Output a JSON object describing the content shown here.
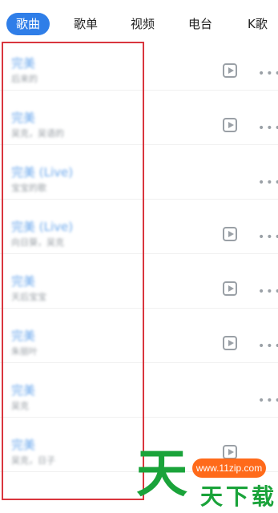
{
  "tabs": [
    {
      "label": "歌曲"
    },
    {
      "label": "歌单"
    },
    {
      "label": "视频"
    },
    {
      "label": "电台"
    },
    {
      "label": "K歌"
    }
  ],
  "songs": [
    {
      "title": "完美",
      "subtitle": "后来的"
    },
    {
      "title": "完美",
      "subtitle": "吴克，吴语的"
    },
    {
      "title": "完美 (Live)",
      "subtitle": "宝宝的歌"
    },
    {
      "title": "完美 (Live)",
      "subtitle": "向日葵，吴克"
    },
    {
      "title": "完美",
      "subtitle": "天后宝宝"
    },
    {
      "title": "完美",
      "subtitle": "朱丽叶"
    },
    {
      "title": "完美",
      "subtitle": "吴克"
    },
    {
      "title": "完美",
      "subtitle": "吴克，日子"
    }
  ],
  "watermark": {
    "url": "www.11zip.com",
    "big": "天",
    "small": "天下载"
  },
  "colors": {
    "accent": "#2f7ee8",
    "highlight_box": "#d9363e",
    "watermark_green": "#1aa33a",
    "watermark_orange": "#ff6a1a"
  }
}
